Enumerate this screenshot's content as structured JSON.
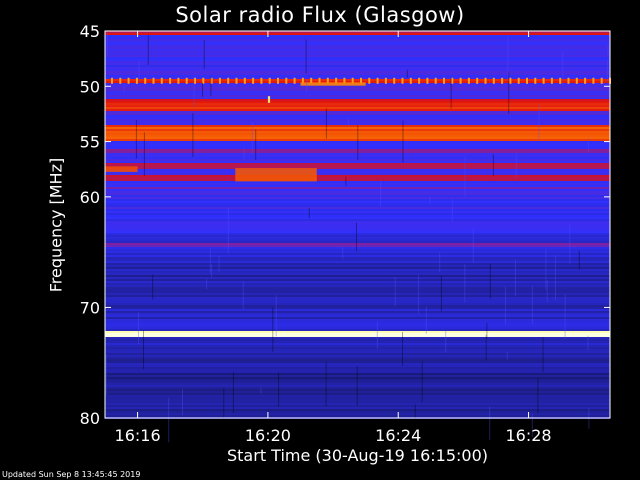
{
  "page": {
    "title": "Solar radio Flux (Glasgow)",
    "xlabel": "Start Time (30-Aug-19 16:15:00)",
    "ylabel": "Frequency [MHz]",
    "footer": "Updated Sun Sep  8 13:45:45 2019"
  },
  "colors": {
    "background": "#000000",
    "text": "#ffffff"
  },
  "chart_data": {
    "type": "heatmap",
    "title": "Solar radio Flux (Glasgow)",
    "xlabel": "Start Time (30-Aug-19 16:15:00)",
    "ylabel": "Frequency [MHz]",
    "x_time_range": [
      "16:15:00",
      "16:30:30"
    ],
    "y_range_mhz": [
      45,
      80
    ],
    "y_inverted": true,
    "x_ticks": [
      "16:16",
      "16:20",
      "16:24",
      "16:28"
    ],
    "y_ticks": [
      45,
      50,
      55,
      60,
      70,
      80
    ],
    "colormap": [
      "#000000",
      "#1e1e8c",
      "#3030ff",
      "#8020a0",
      "#e01010",
      "#ff8000",
      "#ffff80",
      "#ffffff"
    ],
    "background_intensity_by_frequency": [
      {
        "mhz": 45,
        "level": 0.3
      },
      {
        "mhz": 48,
        "level": 0.3
      },
      {
        "mhz": 52,
        "level": 0.32
      },
      {
        "mhz": 56,
        "level": 0.3
      },
      {
        "mhz": 60,
        "level": 0.3
      },
      {
        "mhz": 64,
        "level": 0.26
      },
      {
        "mhz": 67,
        "level": 0.18
      },
      {
        "mhz": 72,
        "level": 0.22
      },
      {
        "mhz": 76,
        "level": 0.15
      },
      {
        "mhz": 80,
        "level": 0.18
      }
    ],
    "bands": [
      {
        "mhz": 45.2,
        "width_mhz": 0.4,
        "level": 0.55
      },
      {
        "mhz": 49.5,
        "width_mhz": 0.4,
        "level": 0.58,
        "dotted": true
      },
      {
        "mhz": 51.7,
        "width_mhz": 1.0,
        "level": 0.62
      },
      {
        "mhz": 54.2,
        "width_mhz": 1.4,
        "level": 0.68
      },
      {
        "mhz": 55.8,
        "width_mhz": 0.3,
        "level": 0.45
      },
      {
        "mhz": 57.2,
        "width_mhz": 0.4,
        "level": 0.5
      },
      {
        "mhz": 58.3,
        "width_mhz": 0.4,
        "level": 0.52
      },
      {
        "mhz": 59.2,
        "width_mhz": 0.3,
        "level": 0.42
      },
      {
        "mhz": 64.3,
        "width_mhz": 0.4,
        "level": 0.42
      },
      {
        "mhz": 72.4,
        "width_mhz": 0.6,
        "level": 0.95
      }
    ],
    "bursts": [
      {
        "t_start": "16:21:00",
        "t_end": "16:23:00",
        "mhz": 49.8,
        "width_mhz": 0.3,
        "level": 0.72
      },
      {
        "t_start": "16:15:00",
        "t_end": "16:16:00",
        "mhz": 57.5,
        "width_mhz": 0.5,
        "level": 0.65
      },
      {
        "t_start": "16:19:00",
        "t_end": "16:21:30",
        "mhz": 58.0,
        "width_mhz": 1.2,
        "level": 0.66
      },
      {
        "t_start": "16:20:00",
        "t_end": "16:20:04",
        "mhz": 51.2,
        "width_mhz": 0.6,
        "level": 0.85
      }
    ]
  }
}
